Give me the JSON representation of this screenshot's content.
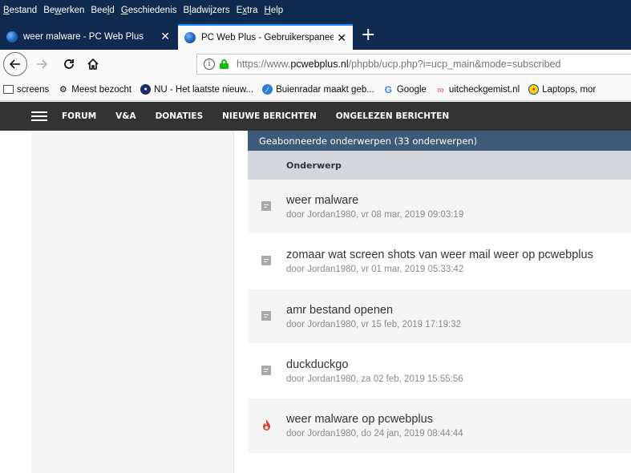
{
  "menu": [
    {
      "pre": "",
      "u": "B",
      "post": "estand"
    },
    {
      "pre": "Be",
      "u": "w",
      "post": "erken"
    },
    {
      "pre": "Bee",
      "u": "l",
      "post": "d"
    },
    {
      "pre": "",
      "u": "G",
      "post": "eschiedenis"
    },
    {
      "pre": "B",
      "u": "l",
      "post": "adwijzers"
    },
    {
      "pre": "E",
      "u": "x",
      "post": "tra"
    },
    {
      "pre": "",
      "u": "H",
      "post": "elp"
    }
  ],
  "tabs": [
    {
      "label": "weer malware - PC Web Plus",
      "close": "✕"
    },
    {
      "label": "PC Web Plus - Gebruikerspaneel",
      "close": "✕"
    }
  ],
  "newtab": "+",
  "url": {
    "scheme": "https://www.",
    "host": "pcwebplus.nl",
    "path": "/phpbb/ucp.php?i=ucp_main&mode=subscribed"
  },
  "bookmarks": [
    {
      "icon": "folder-icon",
      "label": "screens"
    },
    {
      "icon": "gear-icon",
      "label": "Meest bezocht"
    },
    {
      "icon": "nu-icon",
      "label": "NU - Het laatste nieuw..."
    },
    {
      "icon": "buienradar-icon",
      "label": "Buienradar maakt geb..."
    },
    {
      "icon": "google-icon",
      "label": "Google"
    },
    {
      "icon": "uitcheck-icon",
      "label": "uitcheckgemist.nl"
    },
    {
      "icon": "lidl-icon",
      "label": "Laptops, mor"
    }
  ],
  "site_nav": [
    "FORUM",
    "V&A",
    "DONATIES",
    "NIEUWE BERICHTEN",
    "ONGELEZEN BERICHTEN"
  ],
  "panel": {
    "title": "Geabonneerde onderwerpen (33 onderwerpen)",
    "column": "Onderwerp"
  },
  "topics": [
    {
      "title": "weer malware",
      "meta": "door Jordan1980, vr 08 mar, 2019 09:03:19",
      "icon": "topic-icon"
    },
    {
      "title": "zomaar wat screen shots van weer mail weer op pcwebplus",
      "meta": "door Jordan1980, vr 01 mar, 2019 05:33:42",
      "icon": "topic-icon"
    },
    {
      "title": "amr bestand openen",
      "meta": "door Jordan1980, vr 15 feb, 2019 17:19:32",
      "icon": "topic-icon"
    },
    {
      "title": "duckduckgo",
      "meta": "door Jordan1980, za 02 feb, 2019 15:55:56",
      "icon": "topic-icon"
    },
    {
      "title": "weer malware op pcwebplus",
      "meta": "door Jordan1980, do 24 jan, 2019 08:44:44",
      "icon": "hot-topic-icon"
    }
  ],
  "colors": {
    "header": "#333333",
    "panel_title": "#3d5a78",
    "hot": "#d9402b"
  }
}
